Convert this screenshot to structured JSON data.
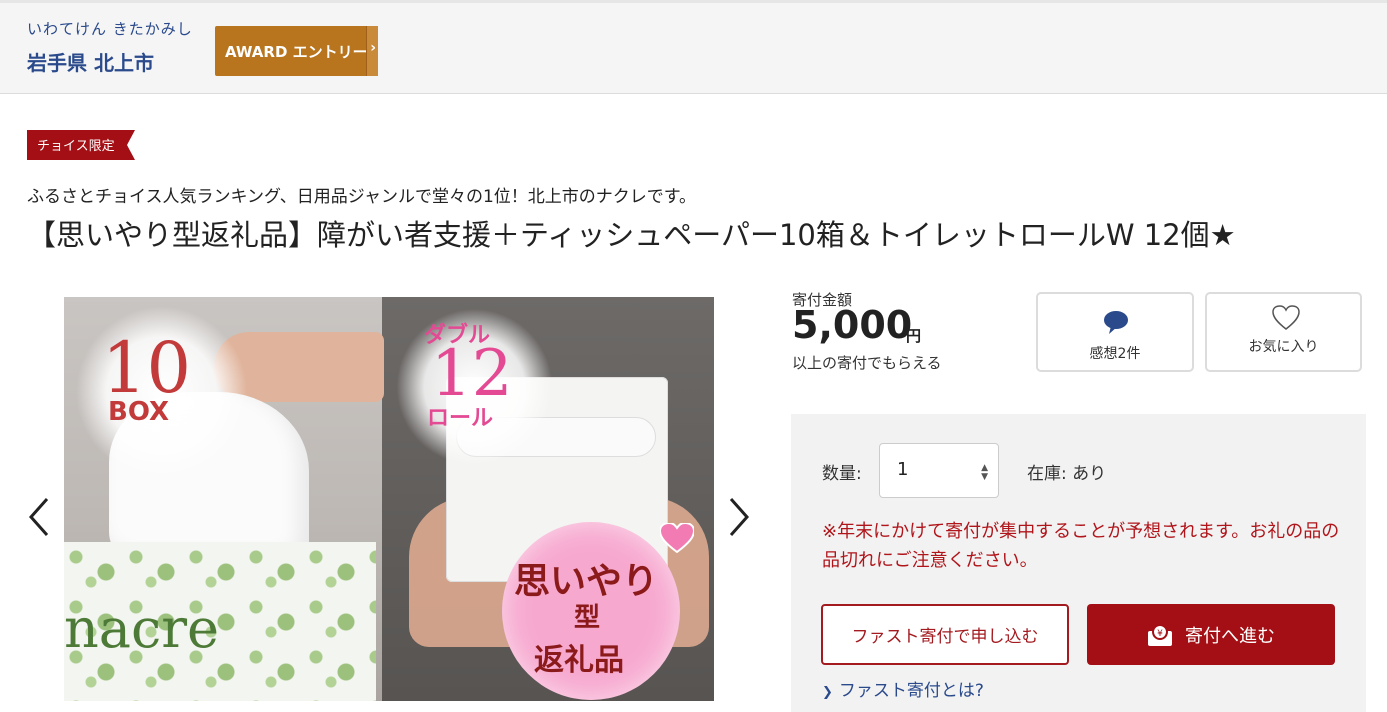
{
  "header": {
    "area_kana": "いわてけん きたかみし",
    "area_name": "岩手県 北上市",
    "award_label": "AWARD エントリー"
  },
  "badge": {
    "label": "チョイス限定"
  },
  "product": {
    "subtitle": "ふるさとチョイス人気ランキング、日用品ジャンルで堂々の1位！北上市のナクレです。",
    "title": "【思いやり型返礼品】障がい者支援＋ティッシュペーパー10箱＆トイレットロールW 12個★"
  },
  "gallery": {
    "left_number": "10",
    "left_unit": "BOX",
    "brand": "nacre",
    "right_top": "ダブル",
    "right_number": "12",
    "right_unit": "ロール",
    "circle_line1": "思いやり",
    "circle_line2": "型",
    "circle_line3": "返礼品",
    "prev_icon": "chevron-left-icon",
    "next_icon": "chevron-right-icon"
  },
  "price": {
    "label": "寄付金額",
    "value": "5,000",
    "unit": "円",
    "note": "以上の寄付でもらえる"
  },
  "actions": {
    "review_label": "感想2件",
    "review_icon": "comment-icon",
    "favorite_label": "お気に入り",
    "favorite_icon": "heart-icon"
  },
  "order": {
    "qty_label": "数量:",
    "qty_value": "1",
    "stock_label": "在庫: あり",
    "notice": "※年末にかけて寄付が集中することが予想されます。お礼の品の品切れにご注意ください。",
    "fast_button": "ファスト寄付で申し込む",
    "donate_button": "寄付へ進む",
    "donate_icon": "gift-icon",
    "fast_link": "ファスト寄付とは?"
  },
  "colors": {
    "brand_red": "#a30f14",
    "link_blue": "#2a4a8c",
    "award_gold": "#b8751e",
    "notice_red": "#b0151b"
  }
}
